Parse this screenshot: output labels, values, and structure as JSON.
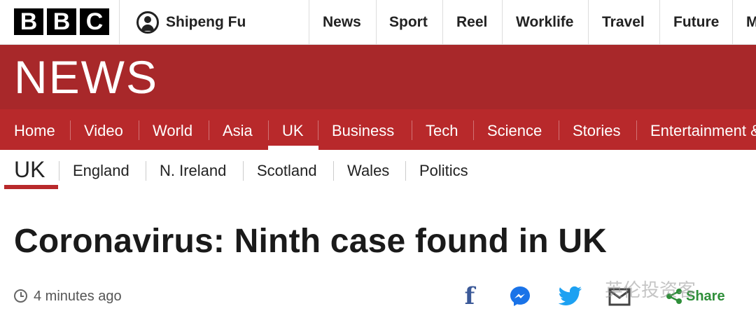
{
  "brand": {
    "logo_letters": [
      "B",
      "B",
      "C"
    ]
  },
  "account": {
    "name": "Shipeng Fu"
  },
  "topnav": {
    "items": [
      "News",
      "Sport",
      "Reel",
      "Worklife",
      "Travel",
      "Future",
      "M"
    ]
  },
  "banner": {
    "title": "NEWS"
  },
  "section_nav": {
    "items": [
      "Home",
      "Video",
      "World",
      "Asia",
      "UK",
      "Business",
      "Tech",
      "Science",
      "Stories",
      "Entertainment &"
    ],
    "active": "UK"
  },
  "sub_nav": {
    "current": "UK",
    "items": [
      "England",
      "N. Ireland",
      "Scotland",
      "Wales",
      "Politics"
    ]
  },
  "article": {
    "headline": "Coronavirus: Ninth case found in UK",
    "timestamp": "4 minutes ago"
  },
  "share": {
    "facebook_glyph": "f",
    "label": "Share",
    "icons": [
      "facebook-icon",
      "messenger-icon",
      "twitter-icon",
      "email-icon",
      "share-icon"
    ]
  },
  "watermark": {
    "text": "英伦投资客"
  },
  "colors": {
    "banner_red": "#a8282a",
    "nav_red": "#b8292b",
    "facebook": "#3b5998",
    "messenger": "#1a73e8",
    "twitter": "#1da1f2",
    "share_green": "#2f8f3a"
  }
}
